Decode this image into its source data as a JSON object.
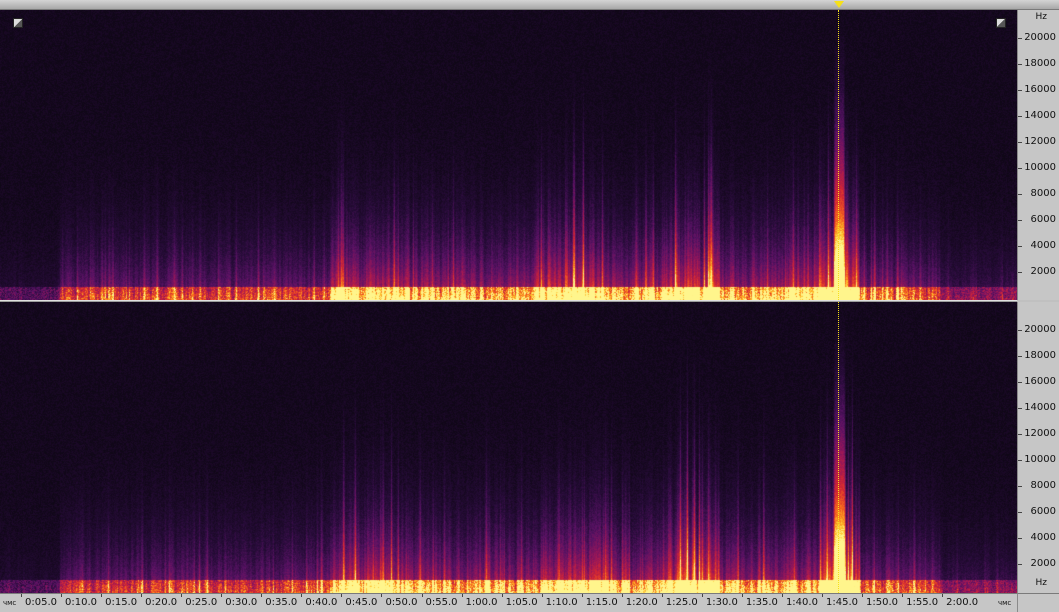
{
  "freq_axis": {
    "unit": "Hz",
    "labels": [
      "20000",
      "18000",
      "16000",
      "14000",
      "12000",
      "10000",
      "8000",
      "6000",
      "4000",
      "2000"
    ]
  },
  "time_axis": {
    "unit": "чмс",
    "labels": [
      "0:05.0",
      "0:10.0",
      "0:15.0",
      "0:20.0",
      "0:25.0",
      "0:30.0",
      "0:35.0",
      "0:40.0",
      "0:45.0",
      "0:50.0",
      "0:55.0",
      "1:00.0",
      "1:05.0",
      "1:10.0",
      "1:15.0",
      "1:20.0",
      "1:25.0",
      "1:30.0",
      "1:35.0",
      "1:40.0",
      "1:45.0",
      "1:50.0",
      "1:55.0",
      "2:00.0"
    ]
  },
  "playhead_time": "1:45.0",
  "colors": {
    "background": "#0c0612",
    "playhead": "#f5e01a",
    "ruler": "#c6c6c6"
  }
}
